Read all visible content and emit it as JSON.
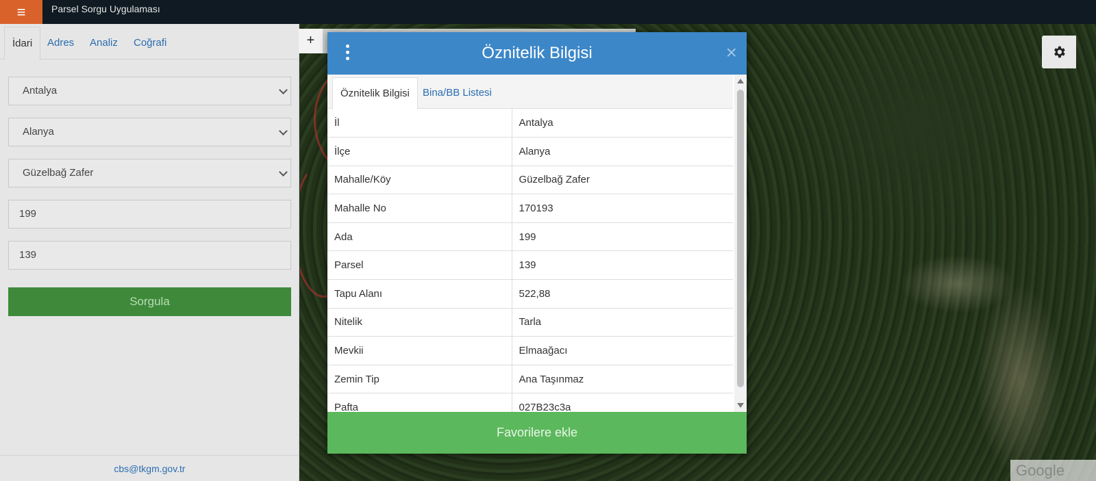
{
  "app": {
    "title": "Parsel Sorgu Uygulaması",
    "menu_icon": "≡"
  },
  "sidebar": {
    "tabs": [
      {
        "label": "İdari",
        "active": true
      },
      {
        "label": "Adres",
        "active": false
      },
      {
        "label": "Analiz",
        "active": false
      },
      {
        "label": "Coğrafi",
        "active": false
      }
    ],
    "il": "Antalya",
    "ilce": "Alanya",
    "mahalle": "Güzelbağ Zafer",
    "ada": "199",
    "parsel": "139",
    "query_button": "Sorgula",
    "footer_email": "cbs@tkgm.gov.tr"
  },
  "map": {
    "zoom_in": "+",
    "attribution": "Google"
  },
  "modal": {
    "title": "Öznitelik Bilgisi",
    "close_icon": "×",
    "tabs": [
      {
        "label": "Öznitelik Bilgisi",
        "active": true
      },
      {
        "label": "Bina/BB Listesi",
        "active": false
      }
    ],
    "rows": [
      {
        "key": "İl",
        "value": "Antalya"
      },
      {
        "key": "İlçe",
        "value": "Alanya"
      },
      {
        "key": "Mahalle/Köy",
        "value": "Güzelbağ Zafer"
      },
      {
        "key": "Mahalle No",
        "value": "170193"
      },
      {
        "key": "Ada",
        "value": "199"
      },
      {
        "key": "Parsel",
        "value": "139"
      },
      {
        "key": "Tapu Alanı",
        "value": "522,88"
      },
      {
        "key": "Nitelik",
        "value": "Tarla"
      },
      {
        "key": "Mevkii",
        "value": "Elmaağacı"
      },
      {
        "key": "Zemin Tip",
        "value": "Ana Taşınmaz"
      },
      {
        "key": "Pafta",
        "value": "027B23c3a"
      }
    ],
    "favorite_button": "Favorilere ekle"
  },
  "colors": {
    "header_blue": "#3c87c8",
    "button_green": "#5cb85c",
    "menu_orange": "#d9622b",
    "link_blue": "#2a6db0"
  }
}
